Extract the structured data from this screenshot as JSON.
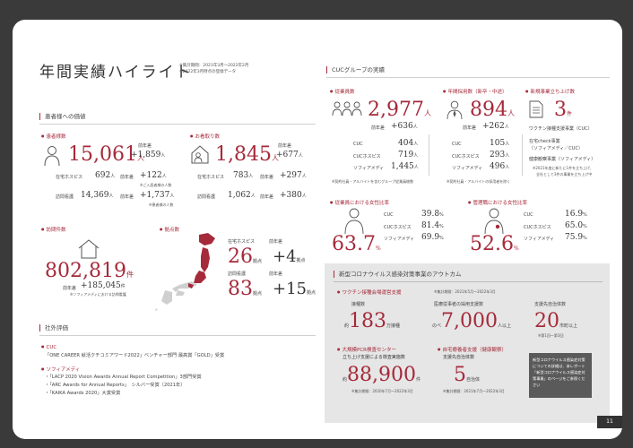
{
  "header": {
    "title": "年間実績ハイライト",
    "period_line1": "※集計期間：2021年3月〜2022年2月",
    "period_line2": "※2022年3月時点の登録データ"
  },
  "patients": {
    "section_title": "患者様への価値",
    "home_patients": {
      "label": "患者様数",
      "value": "15,061",
      "unit": "人",
      "yoy_label": "前年差",
      "yoy": "+1,859",
      "yoy_unit": "人",
      "rows": [
        {
          "label": "在宅ホスピス",
          "value": "692",
          "unit": "人",
          "yoy_label": "前年差",
          "yoy": "+122",
          "yoy_unit": "人",
          "note": "※ご入居者様の人数"
        },
        {
          "label": "訪問看護",
          "value": "14,369",
          "unit": "人",
          "yoy_label": "前年差",
          "yoy": "+1,737",
          "yoy_unit": "人",
          "note": "※患者様の人数"
        }
      ]
    },
    "farewell": {
      "label": "お看取り数",
      "value": "1,845",
      "unit": "人",
      "yoy_label": "前年差",
      "yoy": "+677",
      "yoy_unit": "人",
      "rows": [
        {
          "label": "在宅ホスピス",
          "value": "783",
          "unit": "人",
          "yoy_label": "前年差",
          "yoy": "+297",
          "yoy_unit": "人"
        },
        {
          "label": "訪問看護",
          "value": "1,062",
          "unit": "人",
          "yoy_label": "前年差",
          "yoy": "+380",
          "yoy_unit": "人"
        }
      ]
    },
    "visits": {
      "label": "訪問件数",
      "value": "802,819",
      "unit": "件",
      "yoy_label": "前年差",
      "yoy": "+185,045",
      "yoy_unit": "件",
      "note": "※ソフィアメディにおける訪問看護"
    },
    "locations": {
      "label": "拠点数",
      "rows": [
        {
          "label": "在宅ホスピス",
          "value": "26",
          "unit": "拠点",
          "yoy_label": "前年差",
          "yoy": "+4",
          "yoy_unit": "拠点"
        },
        {
          "label": "訪問看護",
          "value": "83",
          "unit": "拠点",
          "yoy_label": "前年差",
          "yoy": "+15",
          "yoy_unit": "拠点"
        }
      ]
    }
  },
  "external": {
    "section_title": "社外評価",
    "cuc_label": "CUC",
    "cuc_award": "「ONE CAREER 就活クチコミアワード2022」ベンチャー部門 最高賞「GOLD」受賞",
    "sophia_label": "ソフィアメディ",
    "sophia_awards": [
      "・「LACP 2020 Vision Awards Annual Report Competition」3部門受賞",
      "・「ARC Awards for Annual Reports」　シルバー受賞（2021年）",
      "・「KAIKA Awards 2020」大賞受賞"
    ]
  },
  "cuc_group": {
    "section_title": "CUCグループの実績",
    "employees": {
      "label": "従業員数",
      "value": "2,977",
      "unit": "人",
      "yoy_label": "前年差",
      "yoy": "+636",
      "yoy_unit": "人",
      "rows": [
        {
          "label": "CUC",
          "value": "404",
          "unit": "人"
        },
        {
          "label": "CUCホスピス",
          "value": "719",
          "unit": "人"
        },
        {
          "label": "ソフィアメディ",
          "value": "1,445",
          "unit": "人"
        }
      ],
      "note": "※契約社員・アルバイトを含むグループ従業員総数"
    },
    "hires": {
      "label": "年間採用数（新卒・中途）",
      "value": "894",
      "unit": "人",
      "yoy_label": "前年差",
      "yoy": "+262",
      "yoy_unit": "人",
      "rows": [
        {
          "label": "CUC",
          "value": "105",
          "unit": "人"
        },
        {
          "label": "CUCホスピス",
          "value": "293",
          "unit": "人"
        },
        {
          "label": "ソフィアメディ",
          "value": "496",
          "unit": "人"
        }
      ],
      "note": "※契約社員・アルバイトの採用者を除く"
    },
    "new_business": {
      "label": "新規事業立ち上げ数",
      "value": "3",
      "unit": "件",
      "items": [
        "ワクチン接種支援事業（CUC）",
        "在宅check事業",
        "（ソフィアメディ／CUC）",
        "健康観察事業（ソフィアメディ）"
      ],
      "note1": "※2021年度に新たに1件を立ち上げ、",
      "note2": "全社として3件の事業を立ち上げ中"
    },
    "female_employees": {
      "label": "従業員における女性比率",
      "value": "63.7",
      "unit": "%",
      "rows": [
        {
          "label": "CUC",
          "value": "39.8",
          "unit": "%"
        },
        {
          "label": "CUCホスピス",
          "value": "81.4",
          "unit": "%"
        },
        {
          "label": "ソフィアメディ",
          "value": "69.9",
          "unit": "%"
        }
      ]
    },
    "female_managers": {
      "label": "管理職における女性比率",
      "value": "52.6",
      "unit": "%",
      "rows": [
        {
          "label": "CUC",
          "value": "16.9",
          "unit": "%"
        },
        {
          "label": "CUCホスピス",
          "value": "65.0",
          "unit": "%"
        },
        {
          "label": "ソフィアメディ",
          "value": "75.9",
          "unit": "%"
        }
      ]
    }
  },
  "corona": {
    "section_title": "新型コロナウイルス感染対策事業のアウトカム",
    "vaccine_label": "ワクチン接種会場運営支援",
    "vaccine_period": "※集計期間：2021年5月〜2022年3月",
    "stats": [
      {
        "label": "接種数",
        "prefix": "約",
        "value": "183",
        "unit": "万接種"
      },
      {
        "label": "医療従事者の採用支援数",
        "prefix": "のべ",
        "value": "7,000",
        "unit": "人以上"
      },
      {
        "label": "支援先自治体数",
        "prefix": "",
        "value": "20",
        "unit": "市町以上"
      }
    ],
    "stat3_note": "※第1回〜第3回",
    "pcr_label": "大規模PCR検査センター",
    "pcr_label2": "立ち上げ支援による検査実施数",
    "pcr_prefix": "約",
    "pcr_value": "88,900",
    "pcr_unit": "件",
    "pcr_period": "※集計期間：2020年7月〜2022年3月",
    "home_label": "自宅療養者支援（健康観察）",
    "home_label2": "支援先自治体数",
    "home_value": "5",
    "home_unit": "自治体",
    "home_period": "※集計期間：2021年7月〜2022年3月",
    "side_note": "新型コロナウイルス感染症対策についての詳細は、本レポート「新型コロナウイルス感染症対策事業」のページをご参照ください"
  },
  "page_number": "11",
  "colors": {
    "accent": "#a52a3a",
    "grey_box": "#e6e6e6"
  }
}
